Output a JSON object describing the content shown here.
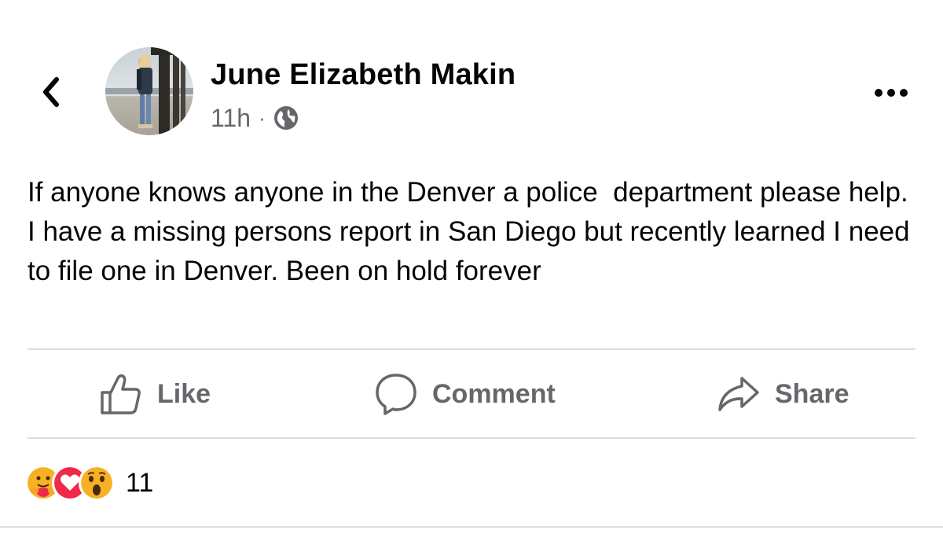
{
  "post": {
    "author": "June Elizabeth Makin",
    "time": "11h",
    "separator": "·",
    "text": "If anyone knows anyone in the Denver a police  department please help. I have a missing persons report in San Diego but recently learned I need to file one in Denver. Been on hold forever"
  },
  "actions": {
    "like": "Like",
    "comment": "Comment",
    "share": "Share"
  },
  "reactions": {
    "types": [
      "care",
      "love",
      "wow"
    ],
    "count": "11"
  },
  "icons": {
    "back": "chevron-left-icon",
    "more": "more-horizontal-icon",
    "audience": "globe-icon",
    "like": "thumbs-up-icon",
    "comment": "comment-bubble-icon",
    "share": "share-arrow-icon"
  },
  "colors": {
    "text": "#050505",
    "secondary": "#65676b",
    "divider": "#dadde1",
    "love": "#f0284a",
    "reaction_yellow": "#f7b125"
  }
}
